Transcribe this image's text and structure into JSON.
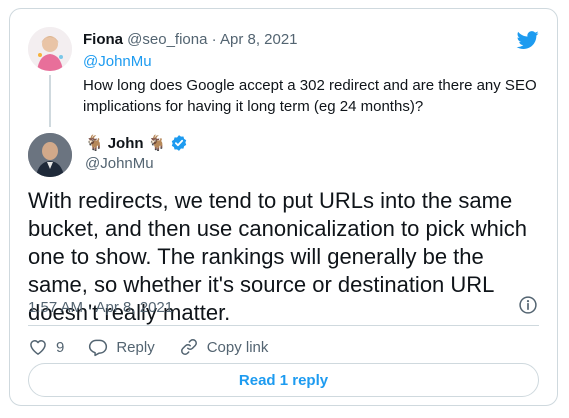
{
  "parent": {
    "name": "Fiona",
    "handle": "@seo_fiona",
    "separator": "·",
    "date": "Apr 8, 2021",
    "replying_to": "@JohnMu",
    "text": "How long does Google accept a 302 redirect and are there any SEO implications for having it long term (eg 24 months)?"
  },
  "main": {
    "name": "John",
    "goat_emoji": "🐐",
    "handle": "@JohnMu",
    "text": "With redirects, we tend to put URLs into the same bucket, and then use canonicalization to pick which one to show. The rankings will generally be the same, so whether it's source or destination URL doesn't really matter.",
    "timestamp": "1:57 AM · Apr 8, 2021"
  },
  "actions": {
    "like_count": "9",
    "reply_label": "Reply",
    "copy_link_label": "Copy link"
  },
  "read_reply_label": "Read 1 reply",
  "colors": {
    "accent": "#1d9bf0",
    "text": "#0f1419",
    "muted": "#536471",
    "border": "#cfd9de"
  },
  "icons": [
    "twitter-bird-icon",
    "verified-badge-icon",
    "info-icon",
    "heart-icon",
    "reply-icon",
    "link-icon"
  ]
}
